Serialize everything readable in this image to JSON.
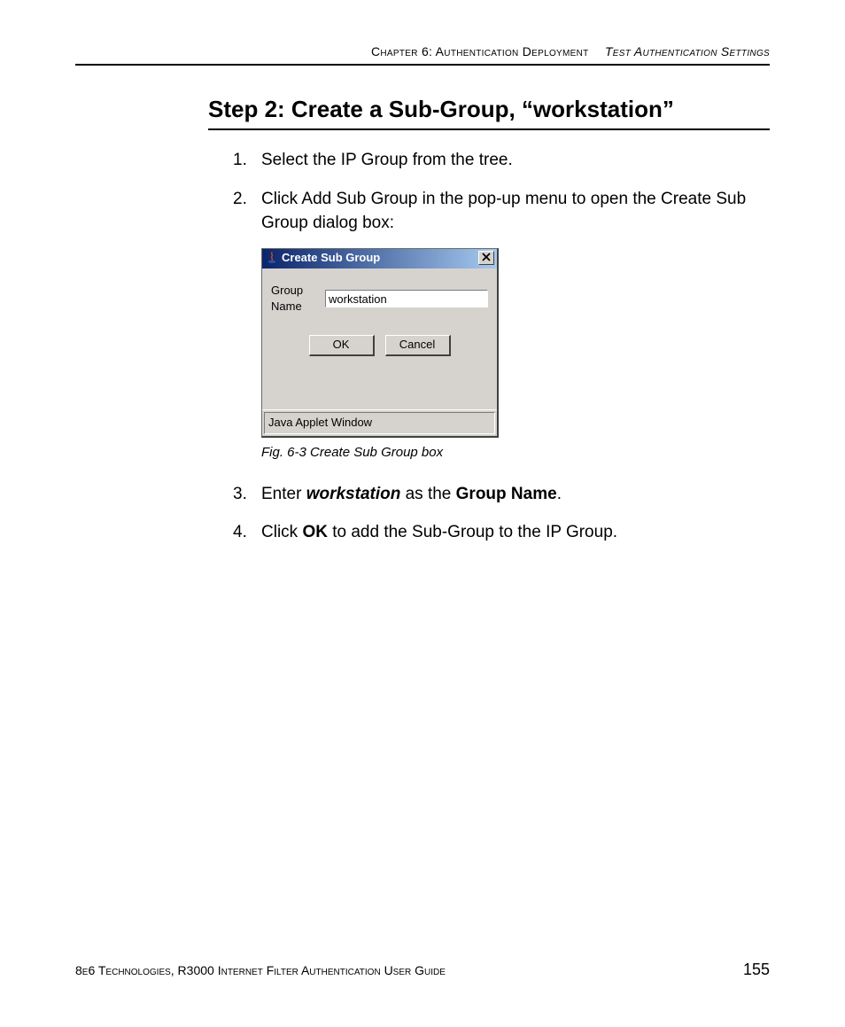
{
  "header": {
    "chapter": "Chapter 6: Authentication Deployment",
    "subsection": "Test Authentication Settings"
  },
  "title": "Step 2: Create a Sub-Group, “workstation”",
  "steps": {
    "s1": "Select the IP Group from the tree.",
    "s2": "Click Add Sub Group in the pop-up menu to open the Create Sub Group dialog box:",
    "s3_pre": "Enter ",
    "s3_em": "workstation",
    "s3_mid": " as the ",
    "s3_b": "Group Name",
    "s3_post": ".",
    "s4_pre": "Click ",
    "s4_b": "OK",
    "s4_post": " to add the Sub-Group to the IP Group."
  },
  "dialog": {
    "title": "Create Sub Group",
    "group_name_label": "Group Name",
    "group_name_value": "workstation",
    "ok": "OK",
    "cancel": "Cancel",
    "status": "Java Applet Window"
  },
  "caption": "Fig. 6-3  Create Sub Group box",
  "footer": {
    "left": "8e6 Technologies, R3000 Internet Filter Authentication User Guide",
    "page": "155"
  }
}
